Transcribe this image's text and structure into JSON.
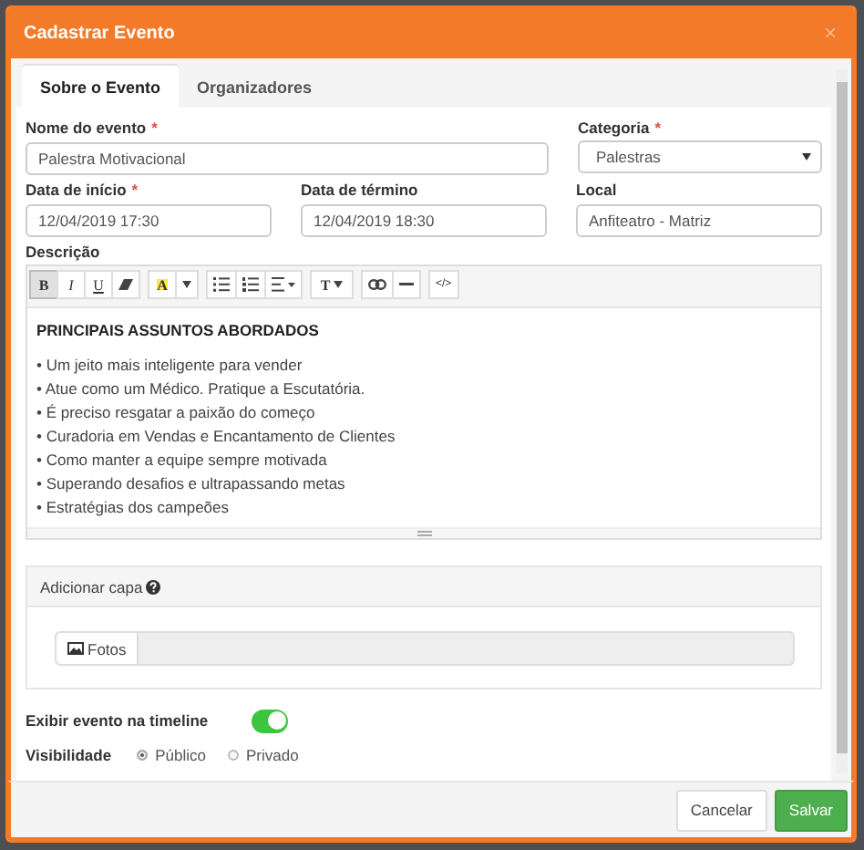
{
  "modal": {
    "title": "Cadastrar Evento",
    "close": "×"
  },
  "tabs": [
    {
      "label": "Sobre o Evento",
      "selected": true
    },
    {
      "label": "Organizadores",
      "selected": false
    }
  ],
  "field_rows": [
    [
      {
        "label": "Nome do evento",
        "mark": "*",
        "kind": "text",
        "value": "Palestra Motivacional"
      },
      {
        "label": "Categoria",
        "mark": "*",
        "kind": "select",
        "value": "Palestras"
      }
    ],
    [
      {
        "label": "Data de início",
        "mark": "*",
        "kind": "text",
        "value": "12/04/2019 17:30"
      },
      {
        "label": "Data de término",
        "kind": "text",
        "value": "12/04/2019 18:30"
      },
      {
        "label": "Local",
        "kind": "text",
        "value": "Anfiteatro - Matriz"
      }
    ]
  ],
  "description": {
    "label": "Descrição",
    "toolbar": [
      [
        {
          "kind": "bold",
          "label": "B",
          "selected": true
        },
        {
          "kind": "italic",
          "label": "I",
          "selected": false
        },
        {
          "kind": "underline",
          "label": "U",
          "selected": false
        },
        {
          "kind": "eraser",
          "selected": false
        }
      ],
      [
        {
          "kind": "highlight",
          "label": "A",
          "selected": false
        },
        {
          "kind": "caret",
          "selected": false
        }
      ],
      [
        {
          "kind": "bullets",
          "selected": false
        },
        {
          "kind": "numbers",
          "selected": false
        },
        {
          "kind": "align",
          "selected": false
        }
      ],
      [
        {
          "kind": "textsize",
          "label": "T",
          "selected": false
        }
      ],
      [
        {
          "kind": "link",
          "selected": false
        },
        {
          "kind": "rule",
          "selected": false
        }
      ],
      [
        {
          "kind": "code",
          "label": "</>",
          "selected": false
        }
      ]
    ],
    "heading": "PRINCIPAIS ASSUNTOS ABORDADOS",
    "items": [
      "• Um jeito mais inteligente para vender",
      "• Atue como um Médico. Pratique a Escutatória.",
      "• É preciso resgatar a paixão do começo",
      "• Curadoria em Vendas e Encantamento de Clientes",
      "• Como manter a equipe sempre motivada",
      "• Superando desafios e ultrapassando metas",
      "• Estratégias dos campeões"
    ]
  },
  "cover": {
    "title": "Adicionar capa",
    "button": "Fotos"
  },
  "timeline": {
    "label": "Exibir evento na timeline",
    "on": true
  },
  "visibility": {
    "label": "Visibilidade",
    "options": [
      {
        "label": "Público",
        "selected": true
      },
      {
        "label": "Privado",
        "selected": false
      }
    ]
  },
  "buttons": [
    {
      "label": "Cancelar",
      "kind": "default"
    },
    {
      "label": "Salvar",
      "kind": "primary"
    }
  ]
}
